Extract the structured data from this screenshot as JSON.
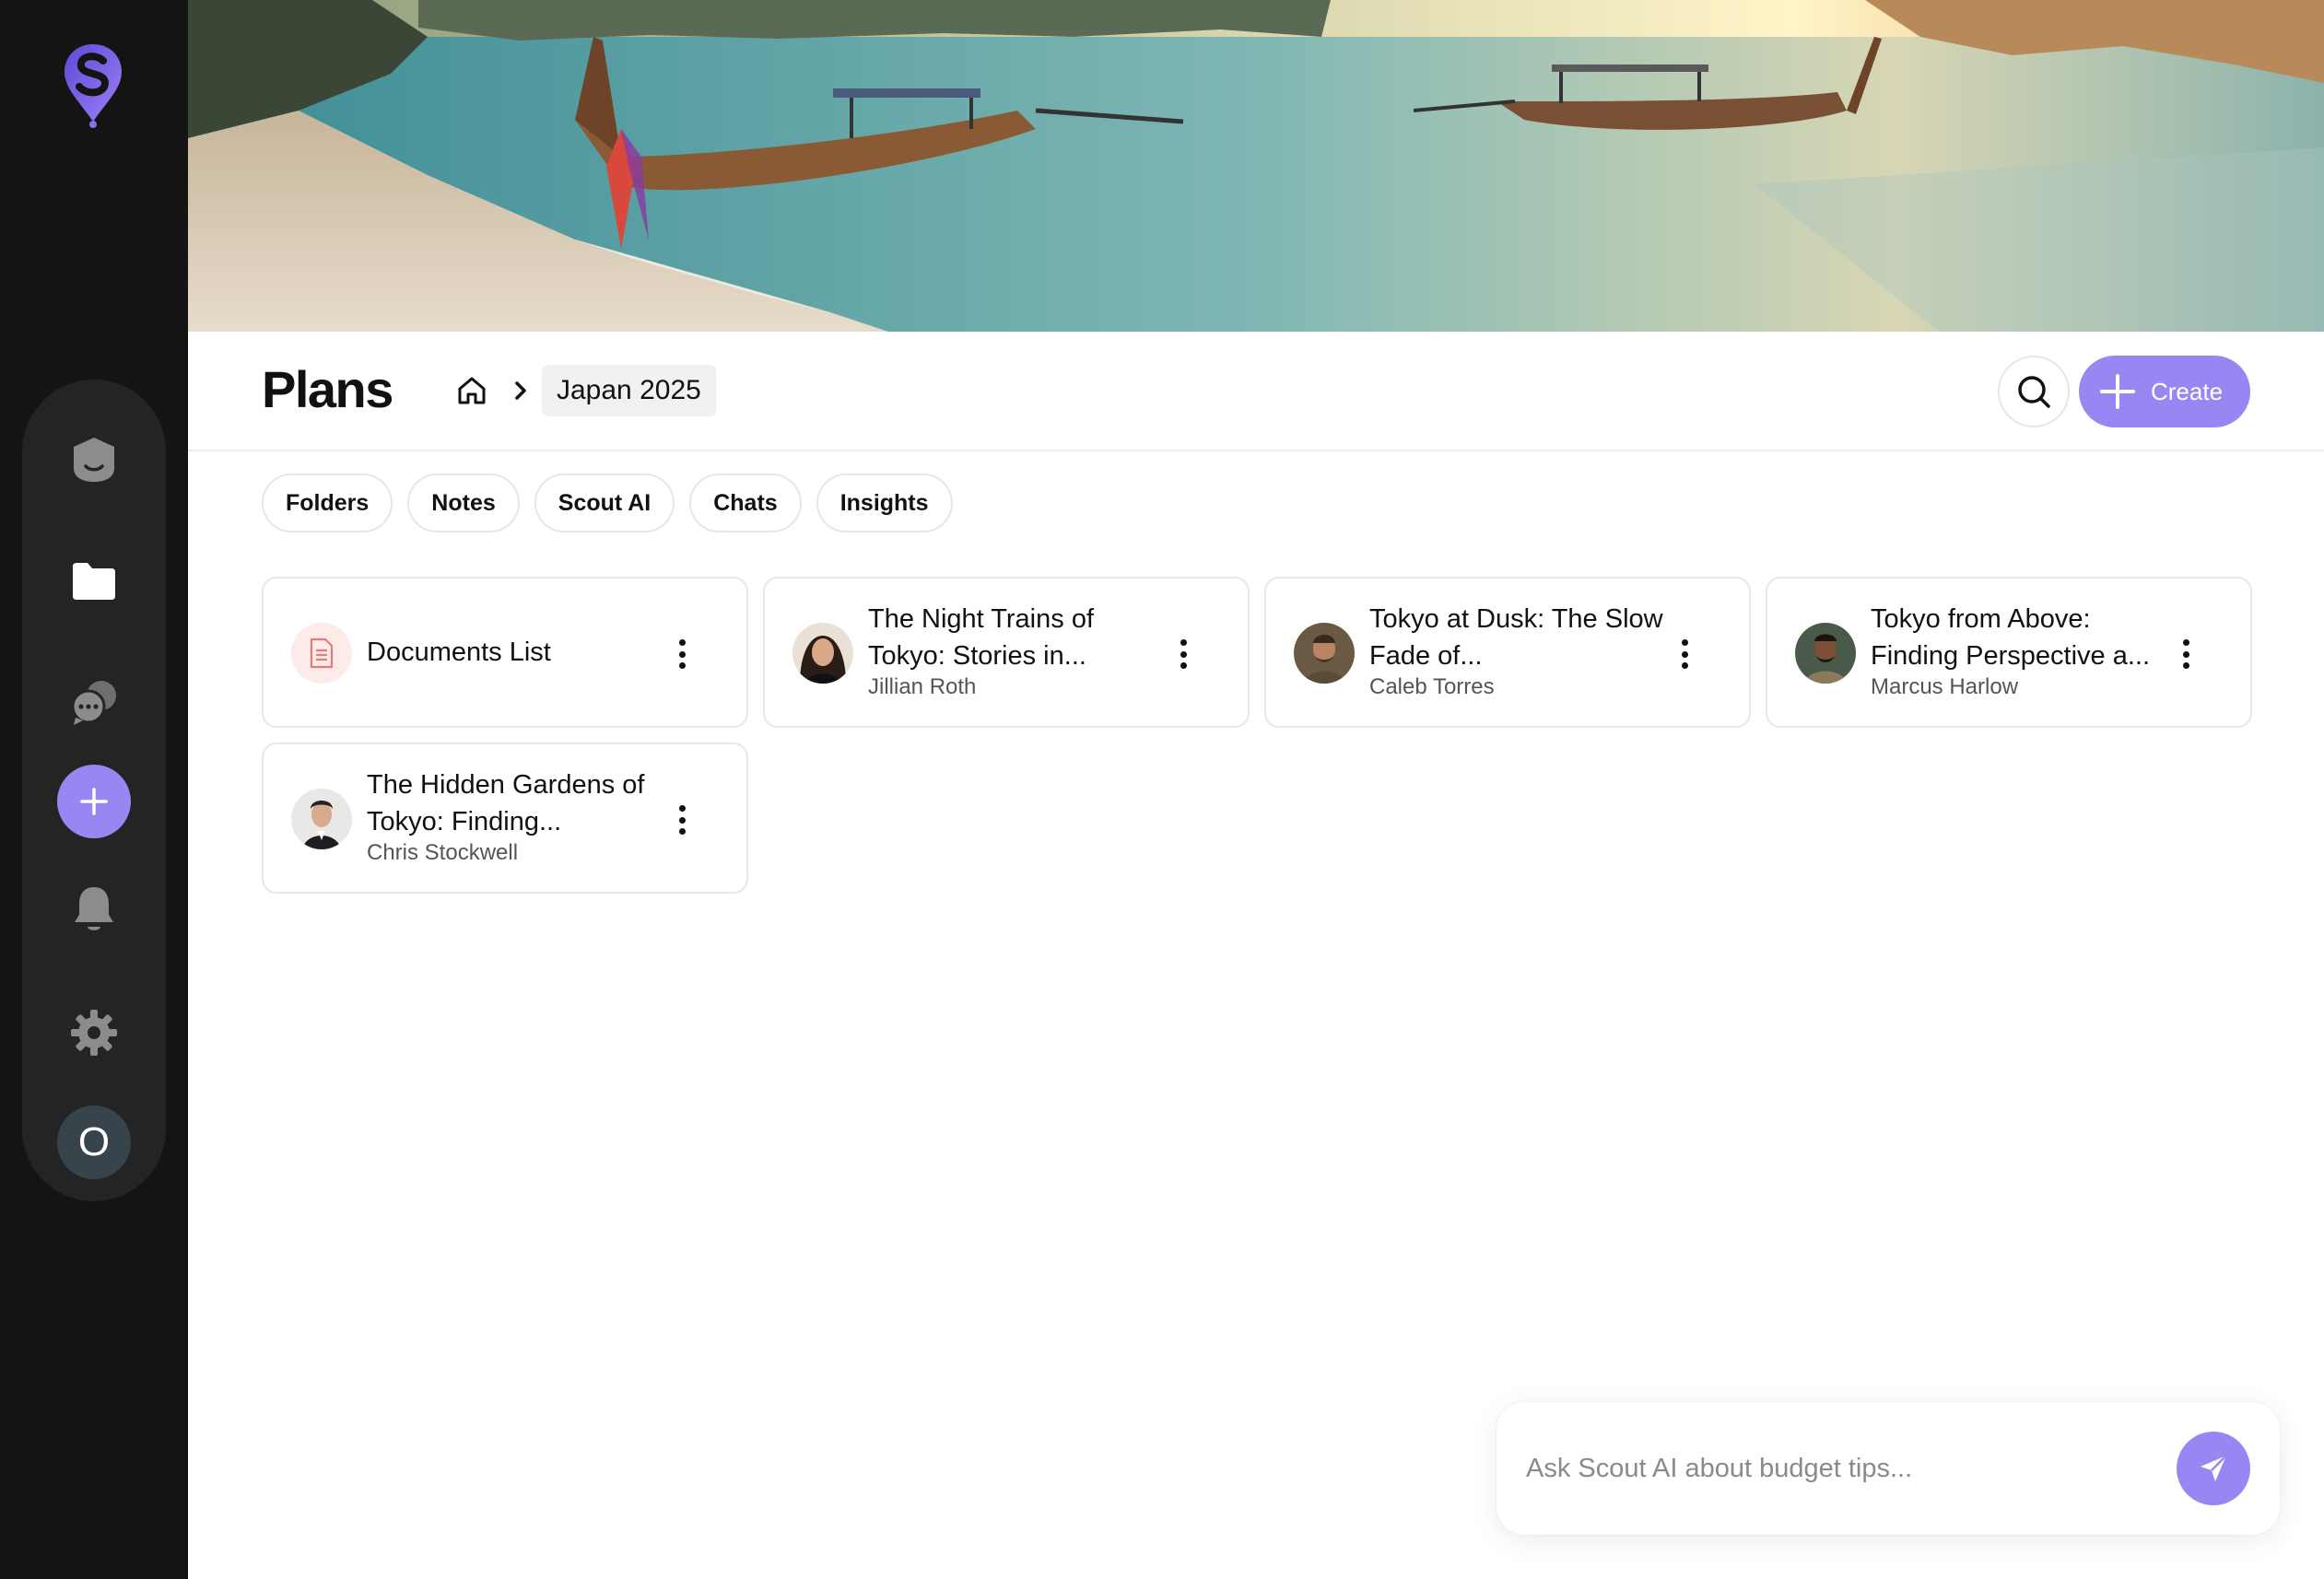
{
  "header": {
    "title": "Plans",
    "breadcrumb_current": "Japan 2025",
    "create_label": "Create"
  },
  "tabs": [
    {
      "label": "Folders"
    },
    {
      "label": "Notes"
    },
    {
      "label": "Scout AI"
    },
    {
      "label": "Chats"
    },
    {
      "label": "Insights"
    }
  ],
  "cards": [
    {
      "title": "Documents List",
      "author": "",
      "icon": "document-icon"
    },
    {
      "title": "The Night Trains of Tokyo: Stories in...",
      "author": "Jillian Roth",
      "icon": "avatar"
    },
    {
      "title": "Tokyo at Dusk: The Slow Fade of...",
      "author": "Caleb Torres",
      "icon": "avatar"
    },
    {
      "title": "Tokyo from Above: Finding Perspective a...",
      "author": "Marcus Harlow",
      "icon": "avatar"
    },
    {
      "title": "The Hidden Gardens of Tokyo: Finding...",
      "author": "Chris Stockwell",
      "icon": "avatar"
    }
  ],
  "sidebar": {
    "items": [
      {
        "icon": "profile-icon"
      },
      {
        "icon": "folder-icon"
      },
      {
        "icon": "chat-icon"
      },
      {
        "icon": "plus-icon"
      },
      {
        "icon": "bell-icon"
      },
      {
        "icon": "gear-icon"
      }
    ],
    "avatar_letter": "O"
  },
  "ask": {
    "placeholder": "Ask Scout AI about budget tips..."
  },
  "colors": {
    "accent": "#9a86f2",
    "sidebar_bg": "#141414",
    "rail_bg": "#242424"
  }
}
